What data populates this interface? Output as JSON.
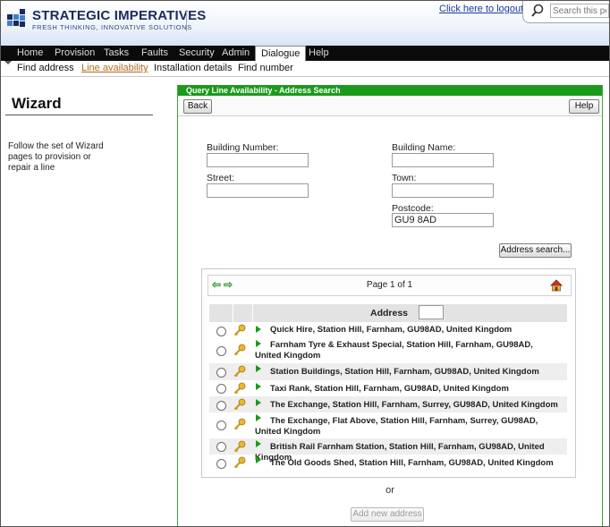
{
  "header": {
    "brand_name": "STRATEGIC IMPERATIVES",
    "brand_tagline": "FRESH THINKING, INNOVATIVE SOLUTIONS",
    "logout_link": "Click here to logout",
    "search_placeholder": "Search this portal"
  },
  "nav": {
    "items": [
      {
        "label": "Home"
      },
      {
        "label": "Provision"
      },
      {
        "label": "Tasks"
      },
      {
        "label": "Faults"
      },
      {
        "label": "Security"
      },
      {
        "label": "Admin"
      },
      {
        "label": "Dialogue"
      },
      {
        "label": "Help"
      }
    ],
    "active": "Dialogue"
  },
  "subnav": {
    "items": [
      {
        "label": "Find address"
      },
      {
        "label": "Line availability"
      },
      {
        "label": "Installation details"
      },
      {
        "label": "Find number"
      }
    ],
    "active": "Line availability"
  },
  "sidebar": {
    "title": "Wizard",
    "description": "Follow the set of Wizard pages to provision or repair a line"
  },
  "panel": {
    "title": "Query Line Availability - Address Search",
    "back_label": "Back",
    "help_label": "Help",
    "form": {
      "building_number_label": "Building Number:",
      "building_number_value": "",
      "building_name_label": "Building Name:",
      "building_name_value": "",
      "street_label": "Street:",
      "street_value": "",
      "town_label": "Town:",
      "town_value": "",
      "postcode_label": "Postcode:",
      "postcode_value": "GU9 8AD",
      "search_button": "Address search..."
    },
    "results": {
      "page_info": "Page 1 of 1",
      "column_header": "Address",
      "filter_value": "",
      "rows": [
        {
          "address": "Quick Hire, Station Hill, Farnham, GU98AD, United Kingdom"
        },
        {
          "address": "Farnham Tyre & Exhaust Special, Station Hill, Farnham, GU98AD, United Kingdom"
        },
        {
          "address": "Station Buildings, Station Hill, Farnham, GU98AD, United Kingdom"
        },
        {
          "address": "Taxi Rank, Station Hill, Farnham, GU98AD, United Kingdom"
        },
        {
          "address": "The Exchange, Station Hill, Farnham, Surrey, GU98AD, United Kingdom"
        },
        {
          "address": "The Exchange, Flat Above, Station Hill, Farnham, Surrey, GU98AD, United Kingdom"
        },
        {
          "address": "British Rail Farnham Station, Station Hill, Farnham, GU98AD, United Kingdom"
        },
        {
          "address": "The Old Goods Shed, Station Hill, Farnham, GU98AD, United Kingdom"
        }
      ]
    },
    "or_text": "or",
    "add_button": "Add new address"
  },
  "colors": {
    "panel_green": "#1c9a1c",
    "nav_black": "#0b0b0b",
    "brand_navy": "#1a2a5c",
    "link_blue": "#1a3a9c",
    "active_subnav": "#b06a20"
  }
}
